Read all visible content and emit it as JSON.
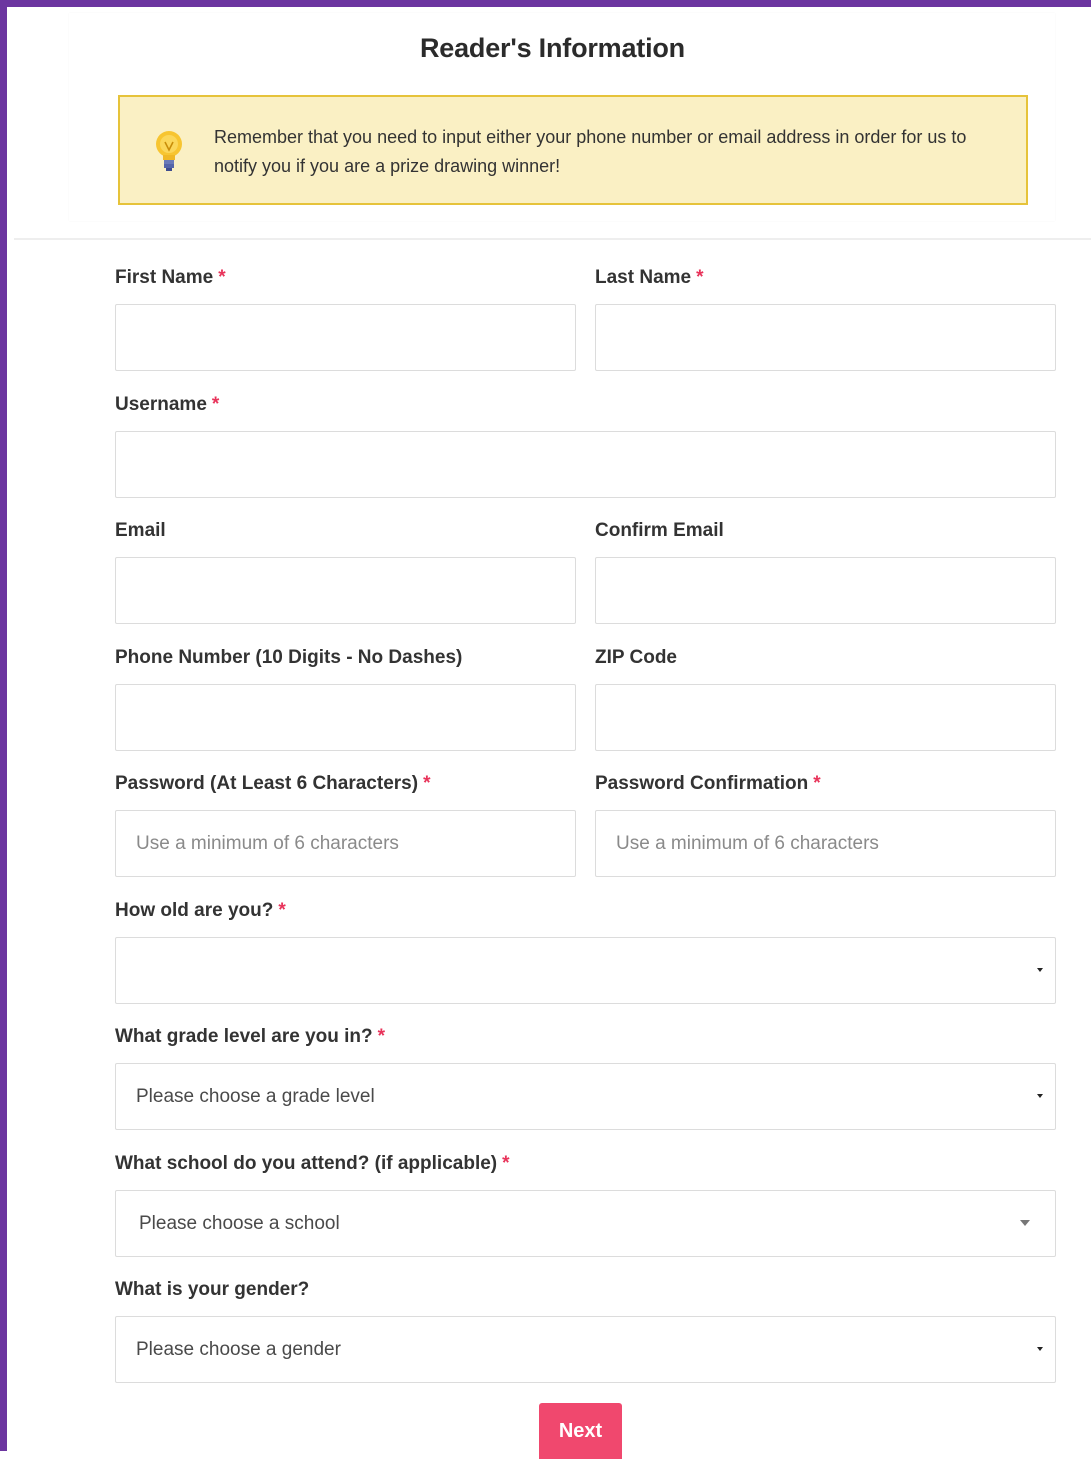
{
  "form": {
    "title": "Reader's Information",
    "notice": "Remember that you need to input either your phone number or email address in order for us to notify you if you are a prize drawing winner!",
    "notice_icon": "lightbulb-icon",
    "required_marker": "*",
    "colors": {
      "frame_border": "#6c35a0",
      "notice_bg": "#faf0c4",
      "notice_border": "#e6c33a",
      "required": "#e8335a",
      "button": "#f0486e"
    }
  },
  "fields": {
    "first_name": {
      "label": "First Name",
      "value": "",
      "placeholder": ""
    },
    "last_name": {
      "label": "Last Name",
      "value": "",
      "placeholder": ""
    },
    "username": {
      "label": "Username",
      "value": "",
      "placeholder": ""
    },
    "email": {
      "label": "Email",
      "value": "",
      "placeholder": ""
    },
    "confirm_email": {
      "label": "Confirm Email",
      "value": "",
      "placeholder": ""
    },
    "phone": {
      "label": "Phone Number (10 Digits - No Dashes)",
      "value": "",
      "placeholder": ""
    },
    "zip": {
      "label": "ZIP Code",
      "value": "",
      "placeholder": ""
    },
    "password": {
      "label": "Password (At Least 6 Characters)",
      "value": "",
      "placeholder": "Use a minimum of 6 characters"
    },
    "password_confirmation": {
      "label": "Password Confirmation",
      "value": "",
      "placeholder": "Use a minimum of 6 characters"
    },
    "age": {
      "label": "How old are you?",
      "selected": ""
    },
    "grade": {
      "label": "What grade level are you in?",
      "selected": "Please choose a grade level"
    },
    "school": {
      "label": "What school do you attend? (if applicable)",
      "selected": "Please choose a school"
    },
    "gender": {
      "label": "What is your gender?",
      "selected": "Please choose a gender"
    }
  },
  "actions": {
    "next_label": "Next"
  }
}
